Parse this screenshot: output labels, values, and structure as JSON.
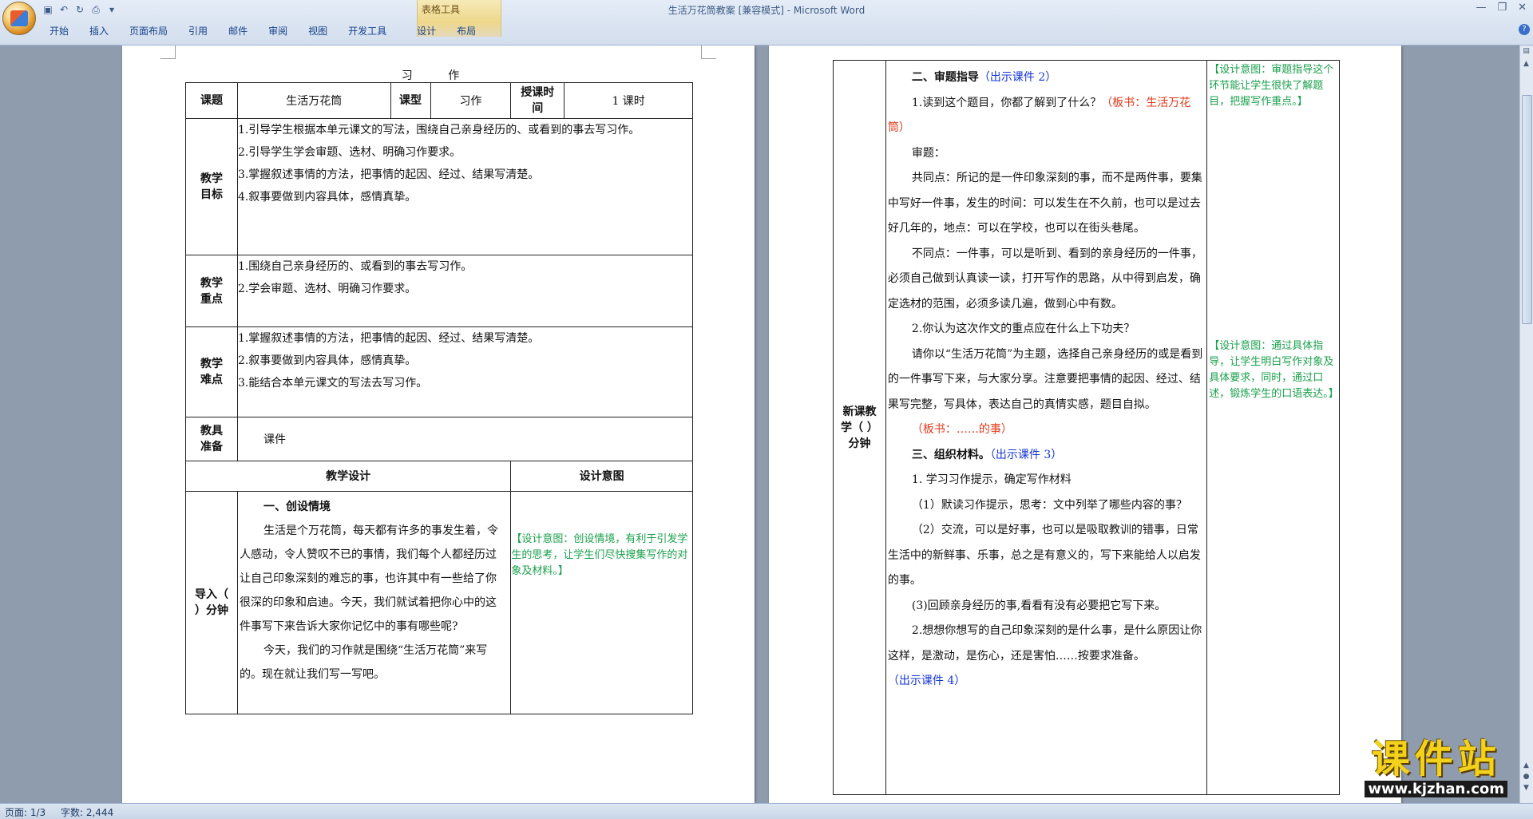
{
  "window": {
    "title": "生活万花筒教案 [兼容模式] - Microsoft Word",
    "contextual_group": "表格工具"
  },
  "ribbon_tabs": [
    "开始",
    "插入",
    "页面布局",
    "引用",
    "邮件",
    "审阅",
    "视图",
    "开发工具",
    "设计",
    "布局"
  ],
  "doc": {
    "heading": "习 作",
    "header_row": {
      "label_topic": "课题",
      "topic": "生活万花筒",
      "label_type": "课型",
      "type": "习作",
      "label_time": "授课时间",
      "time": "1 课时"
    },
    "goals": {
      "label": "教学目标",
      "items": [
        "1.引导学生根据本单元课文的写法，围绕自己亲身经历的、或看到的事去写习作。",
        "2.引导学生学会审题、选材、明确习作要求。",
        "3.掌握叙述事情的方法，把事情的起因、经过、结果写清楚。",
        "4.叙事要做到内容具体，感情真挚。"
      ]
    },
    "key_points": {
      "label": "教学重点",
      "items": [
        "1.围绕自己亲身经历的、或看到的事去写习作。",
        "2.学会审题、选材、明确习作要求。"
      ]
    },
    "difficulties": {
      "label": "教学难点",
      "items": [
        "1.掌握叙述事情的方法，把事情的起因、经过、结果写清楚。",
        "2.叙事要做到内容具体，感情真挚。",
        "3.能结合本单元课文的写法去写习作。"
      ]
    },
    "prep": {
      "label": "教具准备",
      "value": "课件"
    },
    "design_header": {
      "col1": "教学设计",
      "col2": "设计意图"
    },
    "intro": {
      "label": "导入（ ）分钟",
      "heading": "一、创设情境",
      "p1": "生活是个万花筒，每天都有许多的事发生着，令人感动，令人赞叹不已的事情，我们每个人都经历过让自己印象深刻的难忘的事，也许其中有一些给了你很深的印象和启迪。今天，我们就试着把你心中的这件事写下来告诉大家你记忆中的事有哪些呢?",
      "p2": "今天，我们的习作就是围绕“生活万花筒”来写的。现在就让我们写一写吧。",
      "intent": "【设计意图：创设情境，有利于引发学生的思考，让学生们尽快搜集写作的对象及材料。】"
    },
    "newlesson": {
      "label": "新课教学（ ）分钟",
      "s2_title": "二、审题指导",
      "s2_show": "（出示课件 2）",
      "q1": "1.读到这个题目，你都了解到了什么？",
      "q1_board": "（板书：生活万花筒）",
      "shenti": "审题：",
      "common": "共同点：所记的是一件印象深刻的事，而不是两件事，要集中写好一件事，发生的时间：可以发生在不久前，也可以是过去好几年的，地点：可以在学校，也可以在街头巷尾。",
      "diff": "不同点：一件事，可以是听到、看到的亲身经历的一件事，必须自己做到认真读一读，打开写作的思路，从中得到启发，确定选材的范围，必须多读几遍，做到心中有数。",
      "q2": "2.你认为这次作文的重点应在什么上下功夫？",
      "q2_text": "请你以“生活万花筒”为主题，选择自己亲身经历的或是看到的一件事写下来，与大家分享。注意要把事情的起因、经过、结果写完整，写具体，表达自己的真情实感，题目自拟。",
      "board2": "（板书：……的事）",
      "s3_title": "三、组织材料。",
      "s3_show": "（出示课件 3）",
      "s3_1": "1. 学习习作提示，确定写作材料",
      "s3_1a": "（1）默读习作提示，思考：文中列举了哪些内容的事？",
      "s3_1b": "（2）交流，可以是好事，也可以是吸取教训的错事，日常生活中的新鲜事、乐事，总之是有意义的，写下来能给人以启发的事。",
      "s3_1c": "(3)回顾亲身经历的事,看看有没有必要把它写下来。",
      "s3_2": "2.想想你想写的自己印象深刻的是什么事，是什么原因让你这样，是激动，是伤心，还是害怕……按要求准备。",
      "s3_show4": "（出示课件 4）",
      "intent1": "【设计意图：审题指导这个环节能让学生很快了解题目，把握写作重点。】",
      "intent2": "【设计意图：通过具体指导，让学生明白写作对象及具体要求，同时，通过口述，锻炼学生的口语表达。】"
    }
  },
  "status": {
    "page": "页面: 1/3",
    "words": "字数: 2,444"
  },
  "watermark": {
    "brand": "课件站",
    "url": "www.kjzhan.com"
  },
  "colors": {
    "intent_green": "#1aa04c",
    "board_red": "#e03a1a",
    "slide_blue": "#1535d6"
  }
}
